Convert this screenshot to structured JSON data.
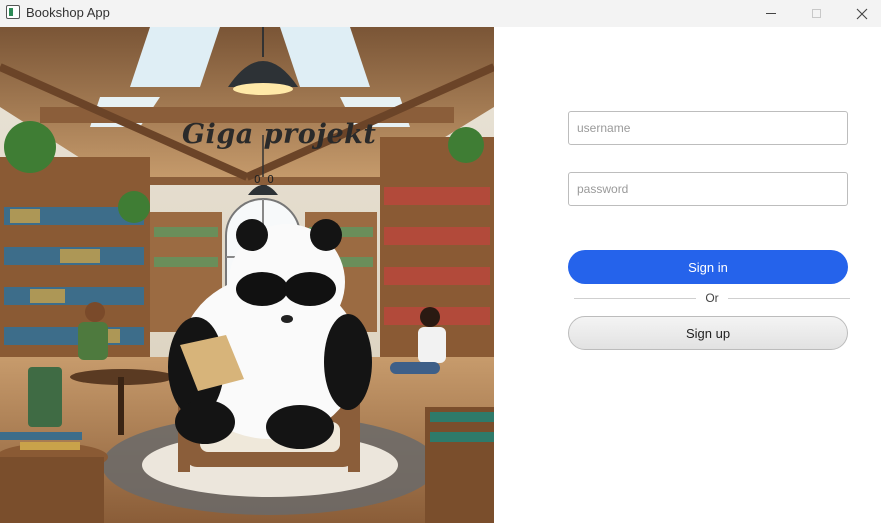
{
  "window": {
    "title": "Bookshop App",
    "controls": [
      "minimize-icon",
      "maximize-icon",
      "close-icon"
    ]
  },
  "illustration": {
    "headline": "Giga projekt",
    "ring_text": "O_O"
  },
  "login": {
    "username_placeholder": "username",
    "password_placeholder": "password",
    "signin_label": "Sign in",
    "divider_label": "Or",
    "signup_label": "Sign up"
  },
  "colors": {
    "primary": "#2563eb",
    "secondary_button": "#e8e8e8",
    "titlebar": "#f3f3f3"
  }
}
